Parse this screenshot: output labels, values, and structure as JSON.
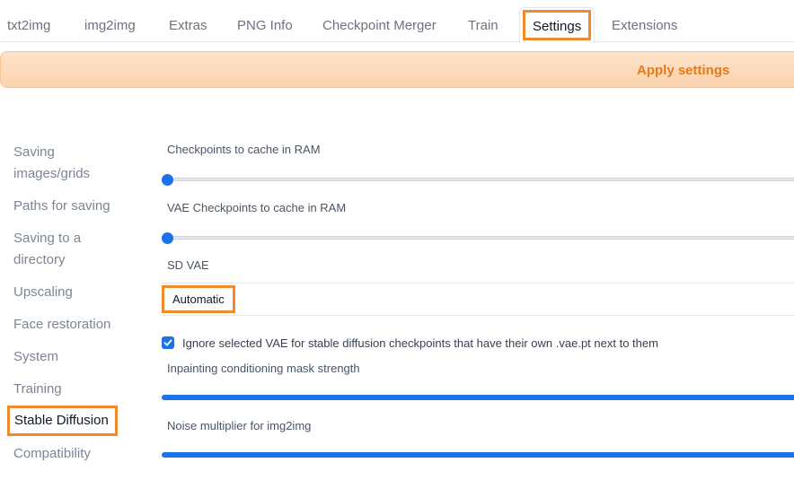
{
  "tabs": [
    {
      "label": "txt2img"
    },
    {
      "label": "img2img"
    },
    {
      "label": "Extras"
    },
    {
      "label": "PNG Info"
    },
    {
      "label": "Checkpoint Merger"
    },
    {
      "label": "Train"
    },
    {
      "label": "Settings",
      "active": true
    },
    {
      "label": "Extensions"
    }
  ],
  "apply": {
    "label": "Apply settings"
  },
  "sidebar": {
    "items": [
      {
        "label": "Saving\nimages/grids"
      },
      {
        "label": "Paths for saving"
      },
      {
        "label": "Saving to a\ndirectory"
      },
      {
        "label": "Upscaling"
      },
      {
        "label": "Face restoration"
      },
      {
        "label": "System"
      },
      {
        "label": "Training"
      },
      {
        "label": "Stable Diffusion",
        "selected": true
      },
      {
        "label": "Compatibility"
      }
    ]
  },
  "settings": {
    "checkpoints_cache": {
      "label": "Checkpoints to cache in RAM",
      "value": 0
    },
    "vae_checkpoints_cache": {
      "label": "VAE Checkpoints to cache in RAM",
      "value": 0
    },
    "sd_vae": {
      "label": "SD VAE",
      "value": "Automatic"
    },
    "ignore_vae": {
      "label": "Ignore selected VAE for stable diffusion checkpoints that have their own .vae.pt next to them",
      "checked": true
    },
    "inpainting_mask_strength": {
      "label": "Inpainting conditioning mask strength",
      "value": 1
    },
    "noise_multiplier": {
      "label": "Noise multiplier for img2img",
      "value": 1
    }
  },
  "colors": {
    "accent": "#1a73e8",
    "highlight": "#f08a2c",
    "apply_text": "#ea7a17"
  }
}
